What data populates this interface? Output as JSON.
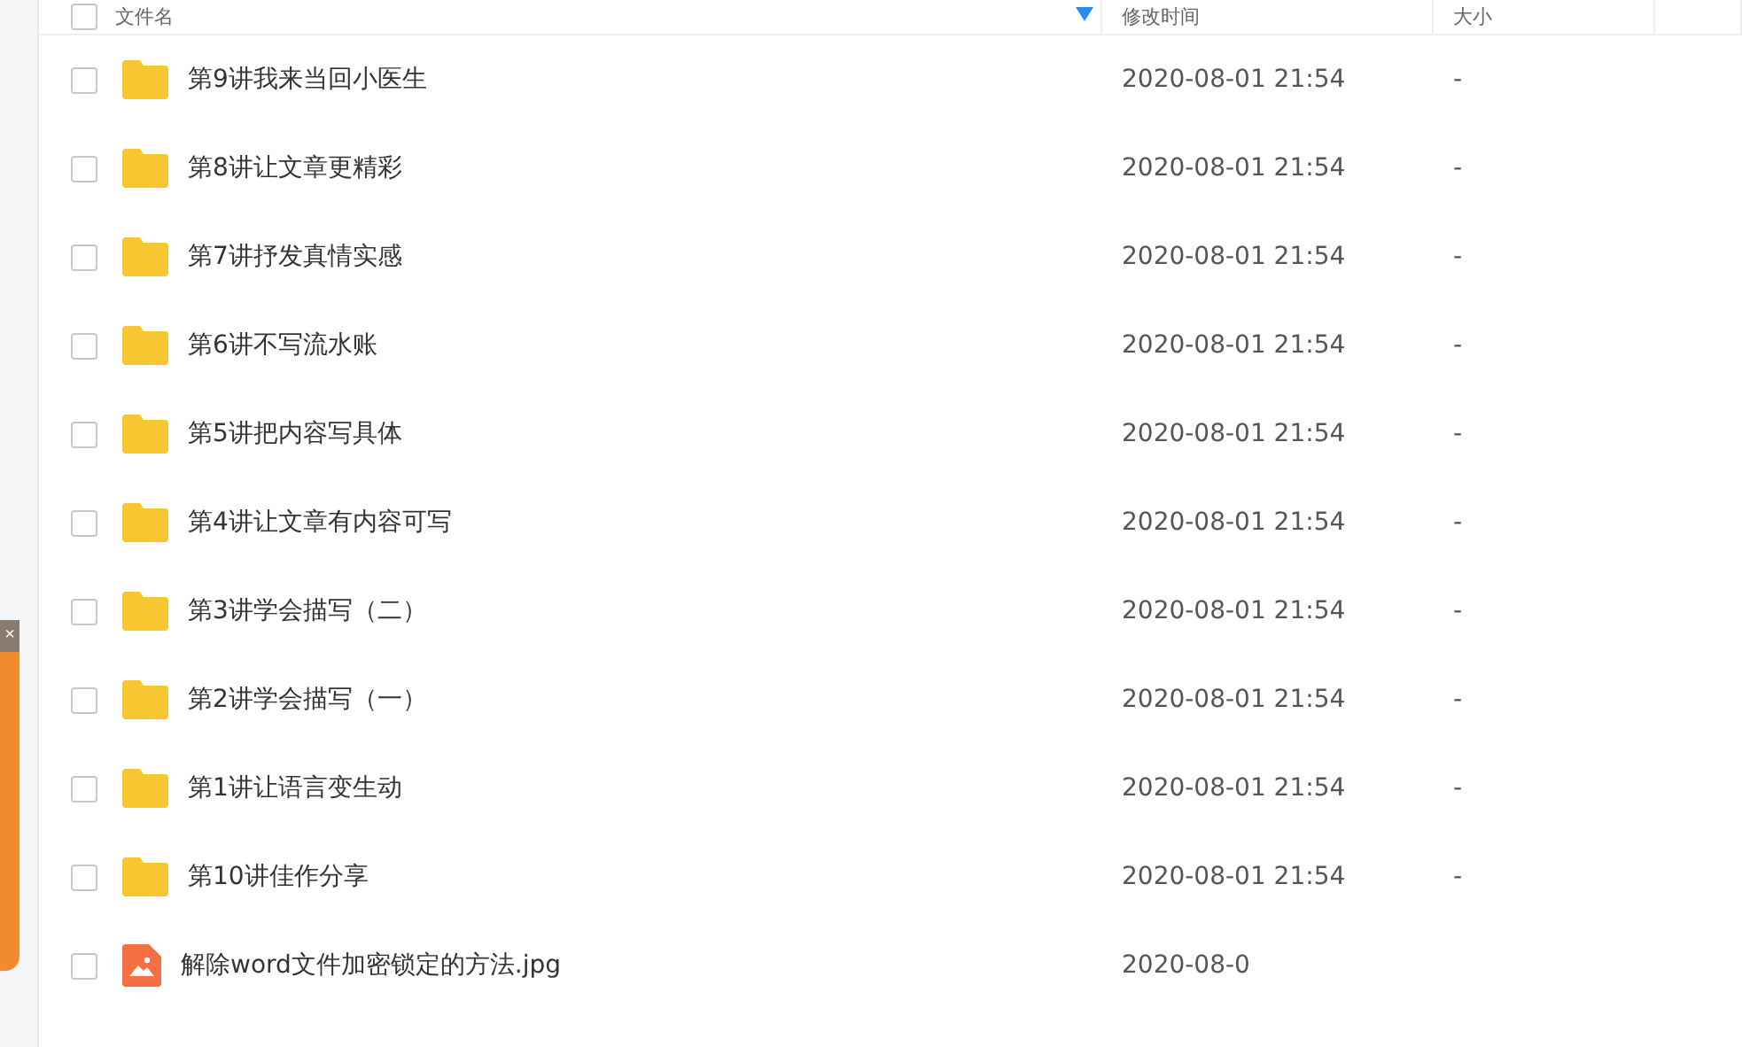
{
  "side_popup": {
    "close": "×"
  },
  "table": {
    "all_checked": false,
    "columns": [
      "文件名",
      "修改时间",
      "大小"
    ],
    "rows": [
      {
        "kind": "folder",
        "name": "第9讲我来当回小医生",
        "modified": "2020-08-01 21:54",
        "size": "-",
        "checked": false
      },
      {
        "kind": "folder",
        "name": "第8讲让文章更精彩",
        "modified": "2020-08-01 21:54",
        "size": "-",
        "checked": false
      },
      {
        "kind": "folder",
        "name": "第7讲抒发真情实感",
        "modified": "2020-08-01 21:54",
        "size": "-",
        "checked": false
      },
      {
        "kind": "folder",
        "name": "第6讲不写流水账",
        "modified": "2020-08-01 21:54",
        "size": "-",
        "checked": false
      },
      {
        "kind": "folder",
        "name": "第5讲把内容写具体",
        "modified": "2020-08-01 21:54",
        "size": "-",
        "checked": false
      },
      {
        "kind": "folder",
        "name": "第4讲让文章有内容可写",
        "modified": "2020-08-01 21:54",
        "size": "-",
        "checked": false
      },
      {
        "kind": "folder",
        "name": "第3讲学会描写（二）",
        "modified": "2020-08-01 21:54",
        "size": "-",
        "checked": false
      },
      {
        "kind": "folder",
        "name": "第2讲学会描写（一）",
        "modified": "2020-08-01 21:54",
        "size": "-",
        "checked": false
      },
      {
        "kind": "folder",
        "name": "第1讲让语言变生动",
        "modified": "2020-08-01 21:54",
        "size": "-",
        "checked": false
      },
      {
        "kind": "folder",
        "name": "第10讲佳作分享",
        "modified": "2020-08-01 21:54",
        "size": "-",
        "checked": false
      },
      {
        "kind": "image",
        "name": "解除word文件加密锁定的方法.jpg",
        "modified": "2020-08-0",
        "checked": false
      }
    ]
  }
}
